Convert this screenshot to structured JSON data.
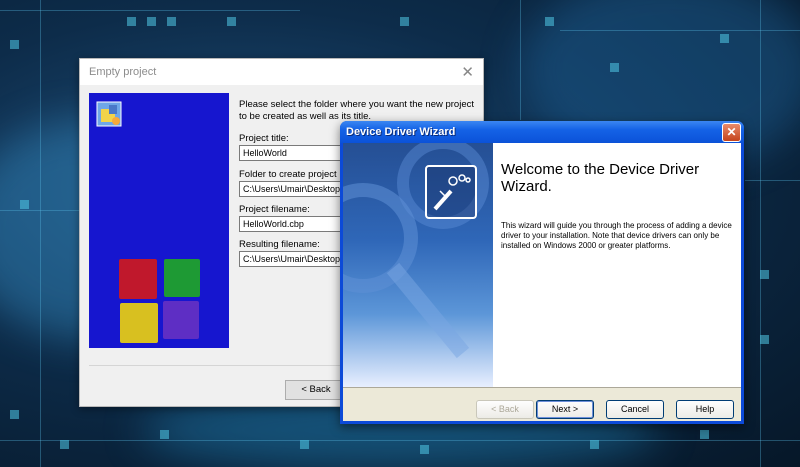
{
  "empty_project": {
    "title": "Empty project",
    "intro": "Please select the folder where you want the new project to be created as well as its title.",
    "project_title_label": "Project title:",
    "project_title_value": "HelloWorld",
    "folder_label": "Folder to create project in:",
    "folder_value": "C:\\Users\\Umair\\Desktop\\",
    "project_filename_label": "Project filename:",
    "project_filename_value": "HelloWorld.cbp",
    "resulting_filename_label": "Resulting filename:",
    "resulting_filename_value": "C:\\Users\\Umair\\Desktop\\",
    "back_button": "< Back"
  },
  "wizard": {
    "title": "Device Driver Wizard",
    "heading": "Welcome to the Device Driver Wizard.",
    "description": "This wizard will guide you through the process of adding a device driver to your installation. Note that device drivers can only be installed on Windows 2000 or greater platforms.",
    "buttons": {
      "back": "< Back",
      "next": "Next >",
      "cancel": "Cancel",
      "help": "Help"
    }
  },
  "colors": {
    "xp_title_blue": "#0b52d8",
    "side_panel_blue": "#1616cf",
    "cube_red": "#c0182c",
    "cube_green": "#1e9a34",
    "cube_yellow": "#d8c020",
    "cube_purple": "#5e2ec4"
  },
  "icons": [
    "close-icon",
    "wand-icon",
    "magic-wand-icon",
    "cube-logo"
  ]
}
